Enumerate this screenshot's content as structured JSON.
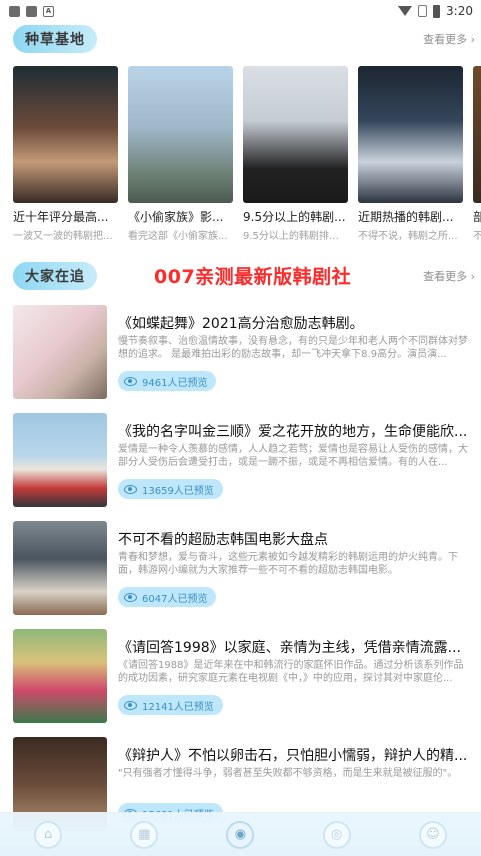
{
  "status_bar": {
    "time": "3:20",
    "icons": [
      "notification-icon",
      "notification-icon",
      "a-icon"
    ]
  },
  "section1": {
    "title": "种草基地",
    "more": "查看更多 ›"
  },
  "cards": [
    {
      "title": "近十年评分最高...",
      "subtitle": "一波又一波的韩剧把..."
    },
    {
      "title": "《小偷家族》影...",
      "subtitle": "看完这部《小偷家族..."
    },
    {
      "title": "9.5分以上的韩剧...",
      "subtitle": "9.5分以上的韩剧排名..."
    },
    {
      "title": "近期热播的韩剧...",
      "subtitle": "不得不说，韩剧之所..."
    },
    {
      "title": "部",
      "subtitle": "不"
    }
  ],
  "section2": {
    "title": "大家在追",
    "more": "查看更多 ›"
  },
  "promo": "007亲测最新版韩剧社",
  "list": [
    {
      "title": "《如蝶起舞》2021高分治愈励志韩剧。",
      "desc": "慢节奏叙事、治愈温情故事，没有悬念，有的只是少年和老人两个不同群体对梦想的追求。 是最难拍出彩的励志故事，却一飞冲天拿下8.9高分。演员演...",
      "views": "9461人已预览"
    },
    {
      "title": "《我的名字叫金三顺》爱之花开放的地方，生命便能欣...",
      "desc": "爱情是一种令人羡慕的感情，人人趋之若骛；爱情也是容易让人受伤的感情，大部分人受伤后会遭受打击，或是一蹶不振，或是不再相信爱情。有的人在...",
      "views": "13659人已预览"
    },
    {
      "title": "不可不看的超励志韩国电影大盘点",
      "desc": "青春和梦想，爱与奋斗，这些元素被如今越发精彩的韩剧运用的炉火纯青。下面，韩游网小编就为大家推荐一些不可不看的超励志韩国电影。",
      "views": "6047人已预览"
    },
    {
      "title": "《请回答1998》以家庭、亲情为主线，凭借亲情流露...",
      "desc": "《请回答1988》是近年来在中和韩流行的家庭怀旧作品。通过分析该系列作品的成功因素，研究家庭元素在电视剧《中，》中的应用，探讨其对中家庭伦...",
      "views": "12141人已预览"
    },
    {
      "title": "《辩护人》不怕以卵击石，只怕胆小懦弱，辩护人的精...",
      "desc": "\"只有强者才懂得斗争，弱者甚至失败都不够资格，而是生来就是被征服的\"。",
      "views": "15681人已预览"
    }
  ],
  "nav": [
    "home-icon",
    "category-icon",
    "discover-icon",
    "location-icon",
    "profile-icon"
  ]
}
